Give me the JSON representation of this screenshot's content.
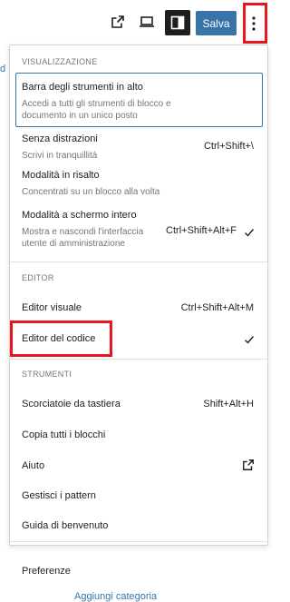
{
  "toolbar": {
    "save_label": "Salva",
    "icons": {
      "view_site": "external-link-icon",
      "preview": "device-preview-icon",
      "settings": "sidebar-toggle-icon",
      "options": "more-vertical-icon"
    }
  },
  "background": {
    "left_edge_text": "d",
    "bottom_link": "Aggiungi categoria"
  },
  "menu": {
    "visualizzazione": {
      "heading": "VISUALIZZAZIONE",
      "items": [
        {
          "label": "Barra degli strumenti in alto",
          "desc": "Accedi a tutti gli strumenti di blocco e documento in un unico posto"
        },
        {
          "label": "Senza distrazioni",
          "desc": "Scrivi in tranquillità",
          "shortcut": "Ctrl+Shift+\\"
        },
        {
          "label": "Modalità in risalto",
          "desc": "Concentrati su un blocco alla volta"
        },
        {
          "label": "Modalità a schermo intero",
          "desc": "Mostra e nascondi l'interfaccia utente di amministrazione",
          "shortcut": "Ctrl+Shift+Alt+F",
          "checked": true
        }
      ]
    },
    "editor": {
      "heading": "EDITOR",
      "items": [
        {
          "label": "Editor visuale",
          "shortcut": "Ctrl+Shift+Alt+M"
        },
        {
          "label": "Editor del codice",
          "checked": true
        }
      ]
    },
    "strumenti": {
      "heading": "STRUMENTI",
      "items": [
        {
          "label": "Scorciatoie da tastiera",
          "shortcut": "Shift+Alt+H"
        },
        {
          "label": "Copia tutti i blocchi"
        },
        {
          "label": "Aiuto",
          "external": true
        },
        {
          "label": "Gestisci i pattern"
        },
        {
          "label": "Guida di benvenuto"
        }
      ]
    },
    "footer": {
      "items": [
        {
          "label": "Preferenze"
        }
      ]
    }
  },
  "colors": {
    "accent": "#3873a9",
    "highlight_frame": "#e8151d",
    "text": "#1e1e1e",
    "muted": "#757575"
  }
}
